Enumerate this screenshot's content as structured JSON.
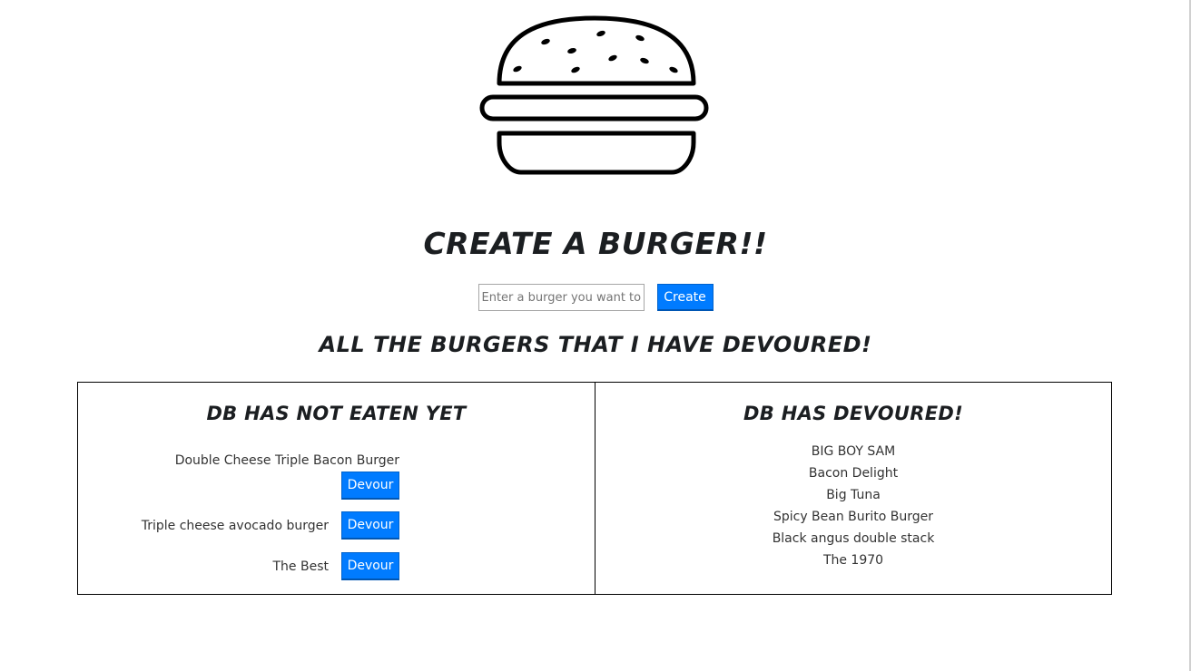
{
  "header": {
    "logo_icon": "burger-icon",
    "create_title": "Create a Burger!!",
    "devoured_title": "All the burgers that I have devoured!"
  },
  "form": {
    "placeholder": "Enter a burger you want to eat",
    "value": "",
    "create_label": "Create"
  },
  "uneaten_panel": {
    "title": "DB has not eaten yet",
    "button_label": "Devour",
    "items": [
      "Double Cheese Triple Bacon Burger",
      "Triple cheese avocado burger",
      "The Best"
    ]
  },
  "devoured_panel": {
    "title": "DB has devoured!",
    "items": [
      "BIG BOY SAM",
      "Bacon Delight",
      "Big Tuna",
      "Spicy Bean Burito Burger",
      "Black angus double stack",
      "The 1970"
    ]
  },
  "colors": {
    "button": "#007bff",
    "text": "#212529"
  }
}
